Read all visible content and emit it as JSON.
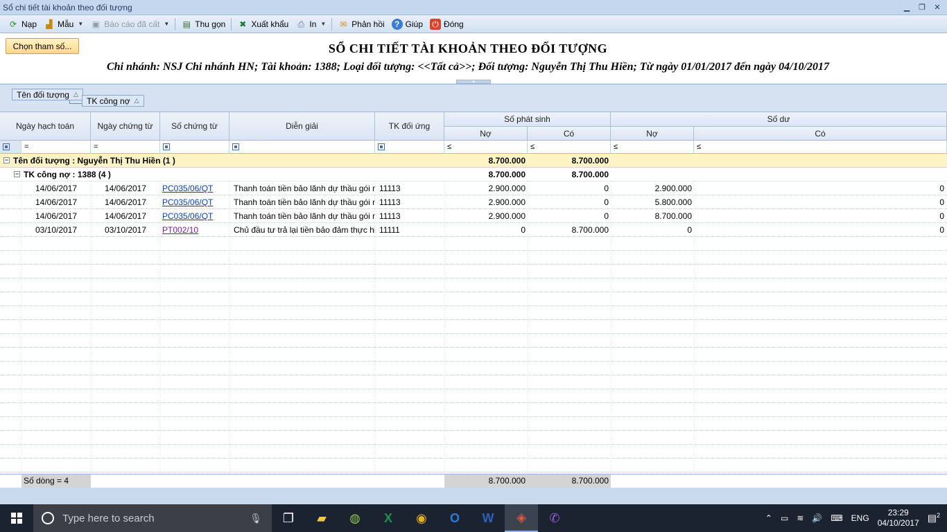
{
  "window": {
    "title": "Sổ chi tiết tài khoản theo đối tượng"
  },
  "toolbar": {
    "items": [
      {
        "label": "Nạp",
        "icon": "refresh-icon"
      },
      {
        "label": "Mẫu",
        "icon": "template-icon"
      },
      {
        "label": "Báo cáo đã cất",
        "icon": "saved-report-icon"
      },
      {
        "label": "Thu gọn",
        "icon": "collapse-icon"
      },
      {
        "label": "Xuất khẩu",
        "icon": "excel-export-icon"
      },
      {
        "label": "In",
        "icon": "print-icon"
      },
      {
        "label": "Phản hồi",
        "icon": "mail-icon"
      },
      {
        "label": "Giúp",
        "icon": "help-icon"
      },
      {
        "label": "Đóng",
        "icon": "power-icon"
      }
    ]
  },
  "header": {
    "params_button": "Chọn tham số...",
    "title": "SỔ CHI TIẾT TÀI KHOẢN THEO ĐỐI TƯỢNG",
    "subtitle": "Chi nhánh: NSJ Chi nhánh HN; Tài khoản: 1388; Loại đối tượng: <<Tất cả>>; Đối tượng: Nguyễn Thị Thu Hiền; Từ ngày 01/01/2017 đến ngày 04/10/2017"
  },
  "group_panel": {
    "chips": [
      "Tên đối tượng",
      "TK công nợ"
    ]
  },
  "grid": {
    "headers": {
      "ngay_hach_toan": "Ngày hạch toán",
      "ngay_chung_tu": "Ngày chứng từ",
      "so_chung_tu": "Số chứng từ",
      "dien_giai": "Diễn giải",
      "tk_doi_ung": "TK đối ứng",
      "so_phat_sinh": "Số phát sinh",
      "so_du": "Số dư",
      "no": "Nợ",
      "co": "Có"
    },
    "filters": {
      "eq": "=",
      "le": "≤"
    },
    "group1": {
      "label": "Tên đối tượng : Nguyễn Thị Thu Hiền (1 )",
      "no": "8.700.000",
      "co": "8.700.000"
    },
    "group2": {
      "label": "TK công nợ : 1388 (4 )",
      "no": "8.700.000",
      "co": "8.700.000"
    },
    "rows": [
      {
        "ngay_ht": "14/06/2017",
        "ngay_ct": "14/06/2017",
        "so_ct": "PC035/06/QT",
        "dien_giai": "Thanh toán tiền bảo lãnh dự thầu gói m",
        "tk": "11113",
        "ps_no": "2.900.000",
        "ps_co": "0",
        "du_no": "2.900.000",
        "du_co": "0"
      },
      {
        "ngay_ht": "14/06/2017",
        "ngay_ct": "14/06/2017",
        "so_ct": "PC035/06/QT",
        "dien_giai": "Thanh toán tiền bảo lãnh dự thầu gói m",
        "tk": "11113",
        "ps_no": "2.900.000",
        "ps_co": "0",
        "du_no": "5.800.000",
        "du_co": "0"
      },
      {
        "ngay_ht": "14/06/2017",
        "ngay_ct": "14/06/2017",
        "so_ct": "PC035/06/QT",
        "dien_giai": "Thanh toán tiền bảo lãnh dự thầu gói m",
        "tk": "11113",
        "ps_no": "2.900.000",
        "ps_co": "0",
        "du_no": "8.700.000",
        "du_co": "0"
      },
      {
        "ngay_ht": "03/10/2017",
        "ngay_ct": "03/10/2017",
        "so_ct": "PT002/10",
        "dien_giai": "Chủ đầu tư trả lại tiền bảo đảm thực hiệ",
        "tk": "11111",
        "ps_no": "0",
        "ps_co": "8.700.000",
        "du_no": "0",
        "du_co": "0"
      }
    ],
    "footer": {
      "count": "Số dòng = 4",
      "total_no": "8.700.000",
      "total_co": "8.700.000"
    }
  },
  "taskbar": {
    "search_placeholder": "Type here to search",
    "language": "ENG",
    "time": "23:29",
    "date": "04/10/2017",
    "notification_count": "2"
  },
  "colors": {
    "group_row": "#fdf3c4",
    "header_bg": "#dbe5f3",
    "taskbar": "#1c2330",
    "link": "#0b40b8",
    "visited_link": "#7b1f8f"
  }
}
